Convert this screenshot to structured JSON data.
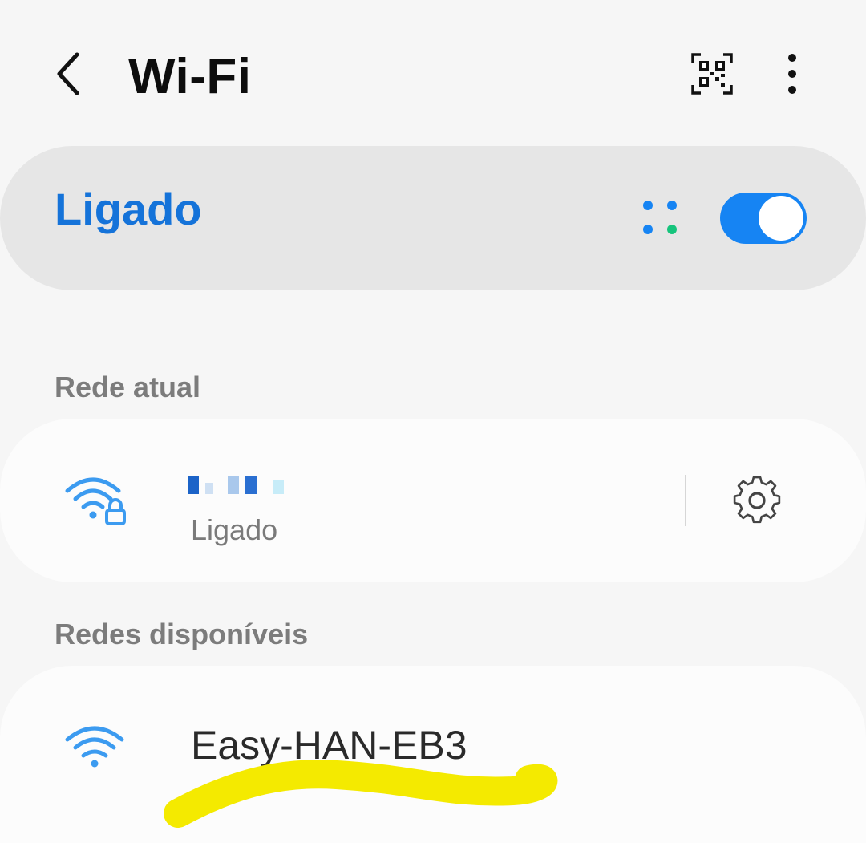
{
  "header": {
    "title": "Wi-Fi",
    "back_icon": "chevron-left-icon",
    "qr_icon": "qr-code-scanner-icon",
    "more_icon": "more-vert-icon"
  },
  "master_toggle": {
    "label": "Ligado",
    "state": "on",
    "accent_color": "#1573d9",
    "switch_color": "#1684f3",
    "indicator_icon": "wifi-direct-dots-icon"
  },
  "current_network": {
    "section_label": "Rede atual",
    "status": "Ligado",
    "signal_icon": "wifi-lock-icon",
    "settings_icon": "gear-icon"
  },
  "available_networks": {
    "section_label": "Redes disponíveis",
    "items": [
      {
        "name": "Easy-HAN-EB3",
        "signal_icon": "wifi-icon"
      }
    ]
  },
  "colors": {
    "background": "#f6f6f6",
    "card": "#fcfcfc",
    "toggle_card": "#e6e6e6",
    "section_text": "#7c7c7c",
    "icon_blue": "#3c9bf0",
    "highlight_yellow": "#f4ea00"
  }
}
